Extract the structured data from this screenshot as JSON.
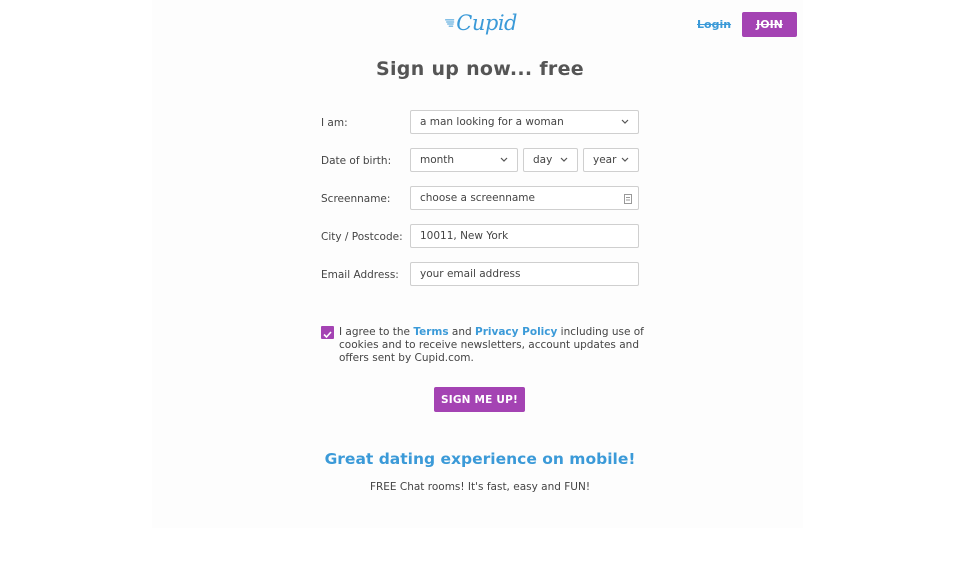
{
  "header": {
    "logo_text": "Cupid",
    "login_label": "Login",
    "join_label": "JOIN"
  },
  "title": "Sign up now... free",
  "form": {
    "iam_label": "I am:",
    "iam_value": "a man looking for a woman",
    "dob_label": "Date of birth:",
    "dob_month": "month",
    "dob_day": "day",
    "dob_year": "year",
    "screenname_label": "Screenname:",
    "screenname_placeholder": "choose a screenname",
    "city_label": "City / Postcode:",
    "city_value": "10011, New York",
    "email_label": "Email Address:",
    "email_placeholder": "your email address"
  },
  "consent": {
    "checked": true,
    "prefix": "I agree to the ",
    "terms": "Terms",
    "and": " and ",
    "privacy": "Privacy Policy",
    "suffix": " including use of cookies and to receive newsletters, account updates and offers sent by Cupid.com."
  },
  "signup_button": "SIGN ME UP!",
  "mobile": {
    "title": "Great dating experience on mobile!",
    "subtitle": "FREE Chat rooms! It's fast, easy and FUN!"
  },
  "colors": {
    "brand_purple": "#a443b3",
    "link_blue": "#3b9ad8"
  },
  "icons": [
    "cupid-wing-icon",
    "chevron-down-icon",
    "id-card-icon",
    "checkmark-icon"
  ]
}
